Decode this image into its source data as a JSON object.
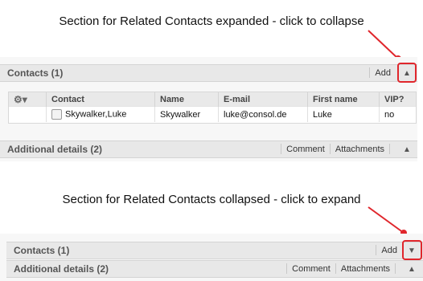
{
  "captions": {
    "top": "Section for Related Contacts expanded - click to collapse",
    "bottom": "Section for Related Contacts collapsed - click to expand"
  },
  "expanded": {
    "contacts_title": "Contacts (1)",
    "add_label": "Add",
    "toggle_icon": "chevron-up-icon",
    "table": {
      "columns": [
        "Contact",
        "Name",
        "E-mail",
        "First name",
        "VIP?"
      ],
      "rows": [
        {
          "contact": "Skywalker,Luke",
          "name": "Skywalker",
          "email": "luke@consol.de",
          "first_name": "Luke",
          "vip": "no"
        }
      ]
    },
    "additional_title": "Additional details (2)",
    "comment_label": "Comment",
    "attachments_label": "Attachments"
  },
  "collapsed": {
    "contacts_title": "Contacts (1)",
    "add_label": "Add",
    "toggle_icon": "chevron-down-icon",
    "additional_title": "Additional details (2)",
    "comment_label": "Comment",
    "attachments_label": "Attachments"
  },
  "colors": {
    "highlight": "#e0262c",
    "header_bg": "#e8e8e8"
  }
}
